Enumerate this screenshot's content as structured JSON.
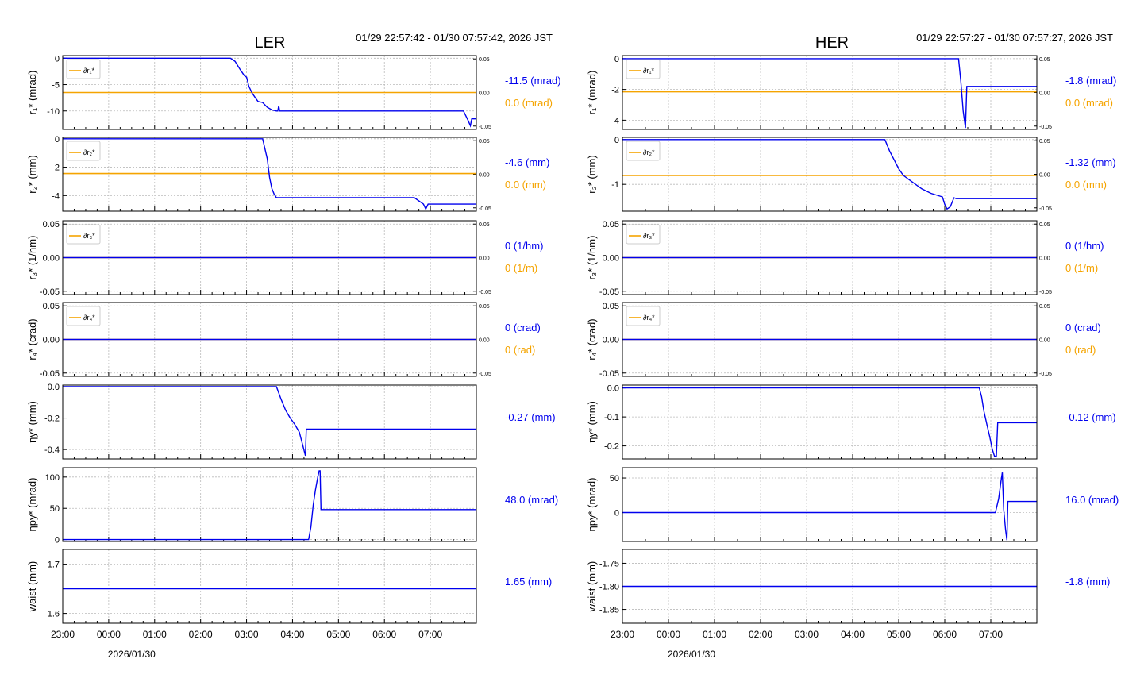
{
  "palette": {
    "trace": "#0000ee",
    "ref": "#f5a400",
    "frame": "#000000",
    "grid": "#bbbbbb"
  },
  "time_axis": {
    "ticks": [
      "23:00",
      "00:00",
      "01:00",
      "02:00",
      "03:00",
      "04:00",
      "05:00",
      "06:00",
      "07:00"
    ],
    "date_label": "2026/01/30"
  },
  "panels": [
    {
      "title": "LER",
      "time_range": "01/29 22:57:42 - 01/30 07:57:42, 2026 JST",
      "rows": [
        {
          "ylabel": "r₁* (mrad)",
          "ylim": [
            -13.5,
            0.5
          ],
          "yticks": [
            0,
            -5,
            -10
          ],
          "tick_labels": [
            "0",
            "-5",
            "-10"
          ],
          "twin": true,
          "twin_ylim": [
            -0.055,
            0.055
          ],
          "twin_ticks": [
            "0.05",
            "0.00",
            "-0.05"
          ],
          "legend": "∂r₁*",
          "ref_value": -6.5,
          "value_text": "-11.5 (mrad)",
          "ref_text": "0.0 (mrad)",
          "line": [
            [
              -1.0,
              0
            ],
            [
              2.65,
              0
            ],
            [
              2.75,
              -0.6
            ],
            [
              2.85,
              -2
            ],
            [
              2.95,
              -3.3
            ],
            [
              3.0,
              -3.6
            ],
            [
              3.05,
              -5.3
            ],
            [
              3.12,
              -6.6
            ],
            [
              3.2,
              -7.6
            ],
            [
              3.25,
              -8.2
            ],
            [
              3.35,
              -8.4
            ],
            [
              3.45,
              -9.3
            ],
            [
              3.55,
              -9.8
            ],
            [
              3.65,
              -10
            ],
            [
              3.68,
              -10
            ],
            [
              3.7,
              -9
            ],
            [
              3.72,
              -10
            ],
            [
              7.72,
              -10
            ],
            [
              7.82,
              -11.8
            ],
            [
              7.87,
              -12.8
            ],
            [
              7.9,
              -11.5
            ],
            [
              8.0,
              -11.5
            ]
          ]
        },
        {
          "ylabel": "r₂* (mm)",
          "ylim": [
            -5.1,
            0.1
          ],
          "yticks": [
            0,
            -2,
            -4
          ],
          "tick_labels": [
            "0",
            "-2",
            "-4"
          ],
          "twin": true,
          "twin_ylim": [
            -0.055,
            0.055
          ],
          "twin_ticks": [
            "0.05",
            "0.00",
            "-0.05"
          ],
          "legend": "∂r₂*",
          "ref_value": -2.45,
          "value_text": "-4.6 (mm)",
          "ref_text": "0.0 (mm)",
          "line": [
            [
              -1.0,
              0
            ],
            [
              3.35,
              0
            ],
            [
              3.45,
              -1.4
            ],
            [
              3.5,
              -2.7
            ],
            [
              3.55,
              -3.5
            ],
            [
              3.6,
              -3.9
            ],
            [
              3.65,
              -4.15
            ],
            [
              6.65,
              -4.15
            ],
            [
              6.85,
              -4.6
            ],
            [
              6.9,
              -4.95
            ],
            [
              6.95,
              -4.6
            ],
            [
              7.5,
              -4.6
            ],
            [
              8.0,
              -4.6
            ]
          ]
        },
        {
          "ylabel": "r₃* (1/hm)",
          "ylim": [
            -0.055,
            0.055
          ],
          "yticks": [
            0.05,
            0,
            -0.05
          ],
          "tick_labels": [
            "0.05",
            "0.00",
            "-0.05"
          ],
          "twin": true,
          "twin_ylim": [
            -0.055,
            0.055
          ],
          "twin_ticks": [
            "0.05",
            "0.00",
            "-0.05"
          ],
          "legend": "∂r₃*",
          "ref_value": 0,
          "value_text": "0 (1/hm)",
          "ref_text": "0 (1/m)",
          "line": [
            [
              -1.0,
              0
            ],
            [
              8.0,
              0
            ]
          ]
        },
        {
          "ylabel": "r₄* (crad)",
          "ylim": [
            -0.055,
            0.055
          ],
          "yticks": [
            0.05,
            0,
            -0.05
          ],
          "tick_labels": [
            "0.05",
            "0.00",
            "-0.05"
          ],
          "twin": true,
          "twin_ylim": [
            -0.055,
            0.055
          ],
          "twin_ticks": [
            "0.05",
            "0.00",
            "-0.05"
          ],
          "legend": "∂r₄*",
          "ref_value": 0,
          "value_text": "0 (crad)",
          "ref_text": "0 (rad)",
          "line": [
            [
              -1.0,
              0
            ],
            [
              8.0,
              0
            ]
          ]
        },
        {
          "ylabel": "ηy* (mm)",
          "ylim": [
            -0.46,
            0.01
          ],
          "yticks": [
            0,
            -0.2,
            -0.4
          ],
          "tick_labels": [
            "0.0",
            "-0.2",
            "-0.4"
          ],
          "twin": false,
          "value_text": "-0.27 (mm)",
          "line": [
            [
              -1.0,
              0
            ],
            [
              3.65,
              0
            ],
            [
              3.75,
              -0.08
            ],
            [
              3.85,
              -0.15
            ],
            [
              3.95,
              -0.2
            ],
            [
              4.05,
              -0.24
            ],
            [
              4.15,
              -0.29
            ],
            [
              4.22,
              -0.37
            ],
            [
              4.28,
              -0.44
            ],
            [
              4.3,
              -0.27
            ],
            [
              8.0,
              -0.27
            ]
          ]
        },
        {
          "ylabel": "ηpy* (mrad)",
          "ylim": [
            -3,
            115
          ],
          "yticks": [
            100,
            50,
            0
          ],
          "tick_labels": [
            "100",
            "50",
            "0"
          ],
          "twin": false,
          "value_text": "48.0 (mrad)",
          "line": [
            [
              -1.0,
              0
            ],
            [
              4.35,
              0
            ],
            [
              4.4,
              20
            ],
            [
              4.45,
              55
            ],
            [
              4.5,
              80
            ],
            [
              4.55,
              100
            ],
            [
              4.58,
              110
            ],
            [
              4.6,
              110
            ],
            [
              4.62,
              48
            ],
            [
              8.0,
              48
            ]
          ]
        },
        {
          "ylabel": "waist (mm)",
          "ylim": [
            1.58,
            1.73
          ],
          "yticks": [
            1.7,
            1.6
          ],
          "tick_labels": [
            "1.7",
            "1.6"
          ],
          "twin": false,
          "value_text": "1.65 (mm)",
          "line": [
            [
              -1.0,
              1.65
            ],
            [
              8.0,
              1.65
            ]
          ]
        }
      ]
    },
    {
      "title": "HER",
      "time_range": "01/29 22:57:27 - 01/30 07:57:27, 2026 JST",
      "rows": [
        {
          "ylabel": "r₁* (mrad)",
          "ylim": [
            -4.6,
            0.2
          ],
          "yticks": [
            0,
            -2,
            -4
          ],
          "tick_labels": [
            "0",
            "-2",
            "-4"
          ],
          "twin": true,
          "twin_ylim": [
            -0.055,
            0.055
          ],
          "twin_ticks": [
            "0.05",
            "0.00",
            "-0.05"
          ],
          "legend": "∂r₁*",
          "ref_value": -2.15,
          "value_text": "-1.8 (mrad)",
          "ref_text": "0.0 (mrad)",
          "line": [
            [
              -1.0,
              0
            ],
            [
              6.3,
              0
            ],
            [
              6.35,
              -1.5
            ],
            [
              6.4,
              -3.4
            ],
            [
              6.45,
              -4.5
            ],
            [
              6.48,
              -1.8
            ],
            [
              8.0,
              -1.8
            ]
          ]
        },
        {
          "ylabel": "r₂* (mm)",
          "ylim": [
            -1.6,
            0.05
          ],
          "yticks": [
            0,
            -1
          ],
          "tick_labels": [
            "0",
            "-1"
          ],
          "twin": true,
          "twin_ylim": [
            -0.055,
            0.055
          ],
          "twin_ticks": [
            "0.05",
            "0.00",
            "-0.05"
          ],
          "legend": "∂r₂*",
          "ref_value": -0.8,
          "value_text": "-1.32 (mm)",
          "ref_text": "0.0 (mm)",
          "line": [
            [
              -1.0,
              0
            ],
            [
              4.7,
              0
            ],
            [
              4.8,
              -0.25
            ],
            [
              4.9,
              -0.45
            ],
            [
              5.0,
              -0.65
            ],
            [
              5.1,
              -0.8
            ],
            [
              5.3,
              -0.95
            ],
            [
              5.5,
              -1.1
            ],
            [
              5.7,
              -1.2
            ],
            [
              5.95,
              -1.28
            ],
            [
              6.0,
              -1.45
            ],
            [
              6.05,
              -1.55
            ],
            [
              6.12,
              -1.5
            ],
            [
              6.2,
              -1.3
            ],
            [
              6.25,
              -1.32
            ],
            [
              8.0,
              -1.32
            ]
          ]
        },
        {
          "ylabel": "r₃* (1/hm)",
          "ylim": [
            -0.055,
            0.055
          ],
          "yticks": [
            0.05,
            0,
            -0.05
          ],
          "tick_labels": [
            "0.05",
            "0.00",
            "-0.05"
          ],
          "twin": true,
          "twin_ylim": [
            -0.055,
            0.055
          ],
          "twin_ticks": [
            "0.05",
            "0.00",
            "-0.05"
          ],
          "legend": "∂r₃*",
          "ref_value": 0,
          "value_text": "0 (1/hm)",
          "ref_text": "0 (1/m)",
          "line": [
            [
              -1.0,
              0
            ],
            [
              8.0,
              0
            ]
          ]
        },
        {
          "ylabel": "r₄* (crad)",
          "ylim": [
            -0.055,
            0.055
          ],
          "yticks": [
            0.05,
            0,
            -0.05
          ],
          "tick_labels": [
            "0.05",
            "0.00",
            "-0.05"
          ],
          "twin": true,
          "twin_ylim": [
            -0.055,
            0.055
          ],
          "twin_ticks": [
            "0.05",
            "0.00",
            "-0.05"
          ],
          "legend": "∂r₄*",
          "ref_value": 0,
          "value_text": "0 (crad)",
          "ref_text": "0 (rad)",
          "line": [
            [
              -1.0,
              0
            ],
            [
              8.0,
              0
            ]
          ]
        },
        {
          "ylabel": "ηy* (mm)",
          "ylim": [
            -0.245,
            0.01
          ],
          "yticks": [
            0,
            -0.1,
            -0.2
          ],
          "tick_labels": [
            "0.0",
            "-0.1",
            "-0.2"
          ],
          "twin": false,
          "value_text": "-0.12 (mm)",
          "line": [
            [
              -1.0,
              0
            ],
            [
              6.75,
              0
            ],
            [
              6.8,
              -0.03
            ],
            [
              6.85,
              -0.08
            ],
            [
              6.92,
              -0.13
            ],
            [
              6.98,
              -0.17
            ],
            [
              7.03,
              -0.21
            ],
            [
              7.08,
              -0.235
            ],
            [
              7.12,
              -0.235
            ],
            [
              7.15,
              -0.12
            ],
            [
              8.0,
              -0.12
            ]
          ]
        },
        {
          "ylabel": "ηpy* (mrad)",
          "ylim": [
            -42,
            65
          ],
          "yticks": [
            50,
            0
          ],
          "tick_labels": [
            "50",
            "0"
          ],
          "twin": false,
          "value_text": "16.0 (mrad)",
          "line": [
            [
              -1.0,
              0
            ],
            [
              7.1,
              0
            ],
            [
              7.17,
              20
            ],
            [
              7.22,
              45
            ],
            [
              7.25,
              58
            ],
            [
              7.28,
              5
            ],
            [
              7.32,
              -25
            ],
            [
              7.35,
              -40
            ],
            [
              7.37,
              16
            ],
            [
              8.0,
              16
            ]
          ]
        },
        {
          "ylabel": "waist (mm)",
          "ylim": [
            -1.88,
            -1.72
          ],
          "yticks": [
            -1.75,
            -1.8,
            -1.85
          ],
          "tick_labels": [
            "-1.75",
            "-1.80",
            "-1.85"
          ],
          "twin": false,
          "value_text": "-1.8 (mm)",
          "line": [
            [
              -1.0,
              -1.8
            ],
            [
              8.0,
              -1.8
            ]
          ]
        }
      ]
    }
  ]
}
